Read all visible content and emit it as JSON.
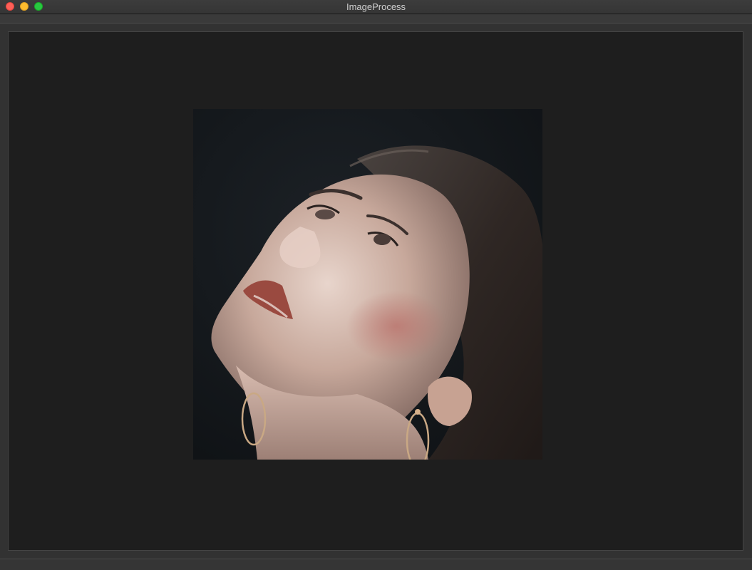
{
  "window": {
    "title": "ImageProcess"
  },
  "image": {
    "description_icon": "photo-portrait"
  },
  "colors": {
    "canvas_background": "#1e1e1e",
    "window_chrome": "#323232"
  }
}
